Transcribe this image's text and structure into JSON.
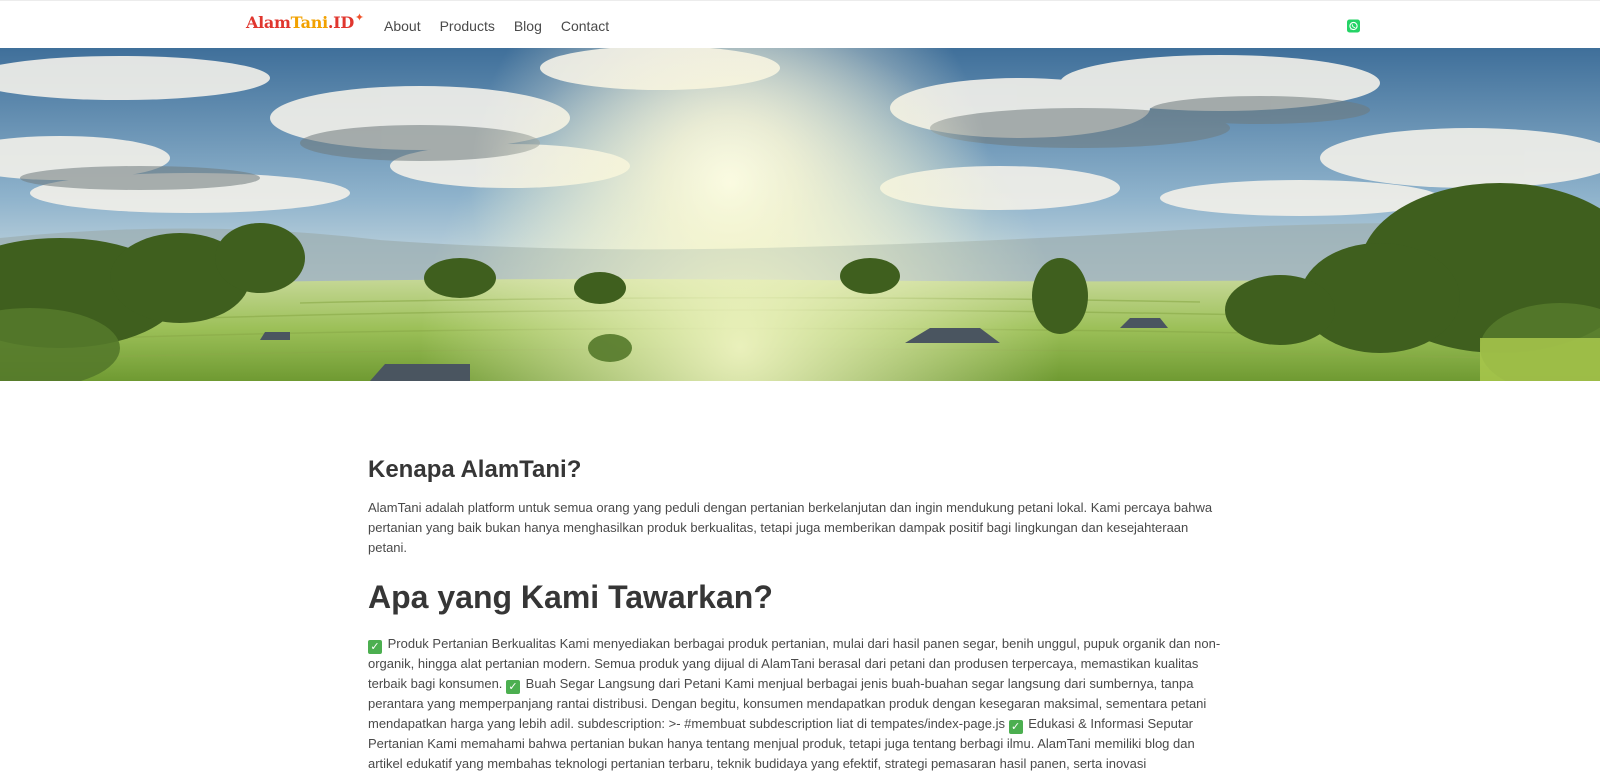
{
  "brand": {
    "part1": "Alam",
    "part2": "Tani",
    "part3": ".ID",
    "spark": "✦"
  },
  "nav": {
    "links": [
      "About",
      "Products",
      "Blog",
      "Contact"
    ]
  },
  "icons": {
    "whatsapp": "whatsapp-icon",
    "check": "check-mark-icon",
    "check_glyph": "✓"
  },
  "colors": {
    "brand_red": "#e0362e",
    "brand_orange": "#f2a100",
    "whatsapp_green": "#25d366",
    "check_green": "#4caf50"
  },
  "main": {
    "why_title": "Kenapa AlamTani?",
    "why_text": "AlamTani adalah platform untuk semua orang yang peduli dengan pertanian berkelanjutan dan ingin mendukung petani lokal. Kami percaya bahwa pertanian yang baik bukan hanya menghasilkan produk berkualitas, tetapi juga memberikan dampak positif bagi lingkungan dan kesejahteraan petani.",
    "offer_title": "Apa yang Kami Tawarkan?",
    "offer_segments": [
      " Produk Pertanian Berkualitas Kami menyediakan berbagai produk pertanian, mulai dari hasil panen segar, benih unggul, pupuk organik dan non-organik, hingga alat pertanian modern. Semua produk yang dijual di AlamTani berasal dari petani dan produsen terpercaya, memastikan kualitas terbaik bagi konsumen. ",
      " Buah Segar Langsung dari Petani Kami menjual berbagai jenis buah-buahan segar langsung dari sumbernya, tanpa perantara yang memperpanjang rantai distribusi. Dengan begitu, konsumen mendapatkan produk dengan kesegaran maksimal, sementara petani mendapatkan harga yang lebih adil. subdescription: >- #membuat subdescription liat di tempates/index-page.js ",
      " Edukasi & Informasi Seputar Pertanian Kami memahami bahwa pertanian bukan hanya tentang menjual produk, tetapi juga tentang berbagi ilmu. AlamTani memiliki blog dan artikel edukatif yang membahas teknologi pertanian terbaru, teknik budidaya yang efektif, strategi pemasaran hasil panen, serta inovasi"
    ]
  }
}
